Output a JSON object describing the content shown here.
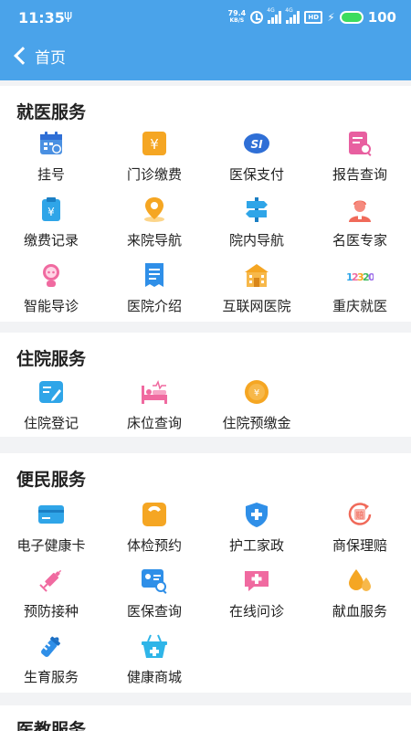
{
  "status": {
    "time": "11:35",
    "usb": "ψ",
    "net_speed_value": "79.4",
    "net_speed_unit": "KB/S",
    "signal1_tag": "4G",
    "signal2_tag": "4G",
    "hd_label": "HD",
    "battery": "100"
  },
  "nav": {
    "back_label": "首页"
  },
  "sections": [
    {
      "title": "就医服务",
      "items": [
        {
          "label": "挂号",
          "icon": "calendar-icon"
        },
        {
          "label": "门诊缴费",
          "icon": "yen-icon"
        },
        {
          "label": "医保支付",
          "icon": "si-badge-icon"
        },
        {
          "label": "报告查询",
          "icon": "report-search-icon"
        },
        {
          "label": "缴费记录",
          "icon": "payment-record-icon"
        },
        {
          "label": "来院导航",
          "icon": "location-icon"
        },
        {
          "label": "院内导航",
          "icon": "signpost-icon"
        },
        {
          "label": "名医专家",
          "icon": "doctor-icon"
        },
        {
          "label": "智能导诊",
          "icon": "robot-icon"
        },
        {
          "label": "医院介绍",
          "icon": "document-icon"
        },
        {
          "label": "互联网医院",
          "icon": "hospital-building-icon"
        },
        {
          "label": "重庆就医",
          "icon": "12320-logo-icon"
        }
      ]
    },
    {
      "title": "住院服务",
      "items": [
        {
          "label": "住院登记",
          "icon": "register-icon"
        },
        {
          "label": "床位查询",
          "icon": "bed-icon"
        },
        {
          "label": "住院预缴金",
          "icon": "deposit-coin-icon"
        }
      ]
    },
    {
      "title": "便民服务",
      "items": [
        {
          "label": "电子健康卡",
          "icon": "card-icon"
        },
        {
          "label": "体检预约",
          "icon": "scale-icon"
        },
        {
          "label": "护工家政",
          "icon": "shield-plus-icon"
        },
        {
          "label": "商保理赔",
          "icon": "claim-refresh-icon"
        },
        {
          "label": "预防接种",
          "icon": "syringe-icon"
        },
        {
          "label": "医保查询",
          "icon": "id-search-icon"
        },
        {
          "label": "在线问诊",
          "icon": "chat-plus-icon"
        },
        {
          "label": "献血服务",
          "icon": "blood-drop-icon"
        },
        {
          "label": "生育服务",
          "icon": "baby-bottle-icon"
        },
        {
          "label": "健康商城",
          "icon": "basket-plus-icon"
        }
      ]
    },
    {
      "title": "医教服务",
      "items": []
    }
  ],
  "icon_colors": {
    "calendar": "#4a90e2",
    "yen": "#f5a623",
    "si": "#2f6fd6",
    "report": "#e85fa0",
    "payment": "#2fa5e8",
    "location": "#f5a623",
    "signpost": "#2fa5e8",
    "doctor": "#f06a5a",
    "robot": "#f06aa0",
    "document": "#2f8fe8",
    "hospital": "#f5a623",
    "register": "#2fa5e8",
    "bed": "#f06aa0",
    "deposit": "#f5a623",
    "card": "#2fa5e8",
    "scale": "#f5a623",
    "shield": "#2f8fe8",
    "claim": "#f06a5a",
    "syringe": "#f06aa0",
    "idsearch": "#2f8fe8",
    "chat": "#f06aa0",
    "blood": "#f5a623",
    "bottle": "#2f8fe8",
    "basket": "#2fb5e8"
  }
}
